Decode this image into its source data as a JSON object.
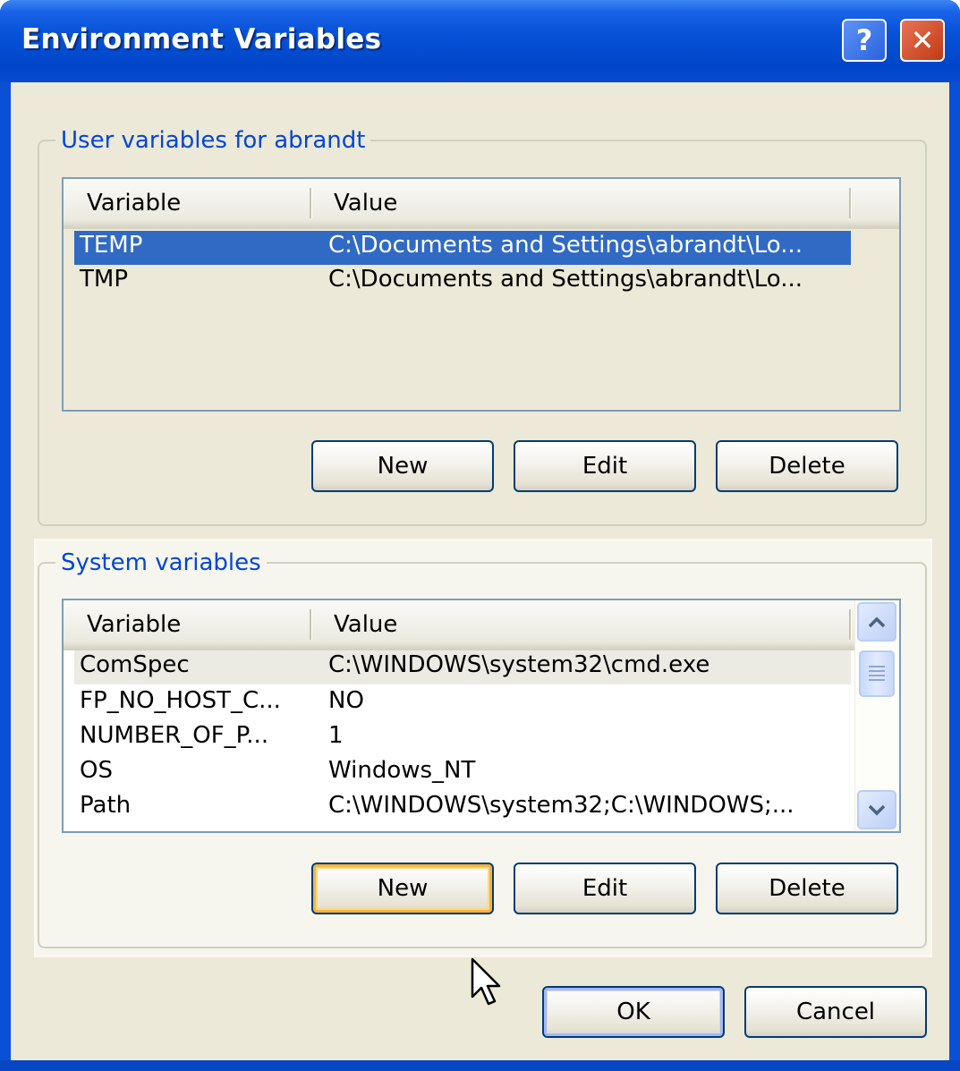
{
  "window": {
    "title": "Environment Variables",
    "help_glyph": "?",
    "close_glyph": "✕"
  },
  "user_group": {
    "label": "User variables for abrandt",
    "columns": [
      "Variable",
      "Value"
    ],
    "rows": [
      {
        "variable": "TEMP",
        "value": "C:\\Documents and Settings\\abrandt\\Lo..."
      },
      {
        "variable": "TMP",
        "value": "C:\\Documents and Settings\\abrandt\\Lo..."
      }
    ],
    "selected_row": "TEMP",
    "buttons": {
      "new": "New",
      "edit": "Edit",
      "delete": "Delete"
    }
  },
  "system_group": {
    "label": "System variables",
    "columns": [
      "Variable",
      "Value"
    ],
    "rows": [
      {
        "variable": "ComSpec",
        "value": "C:\\WINDOWS\\system32\\cmd.exe"
      },
      {
        "variable": "FP_NO_HOST_C...",
        "value": "NO"
      },
      {
        "variable": "NUMBER_OF_P...",
        "value": "1"
      },
      {
        "variable": "OS",
        "value": "Windows_NT"
      },
      {
        "variable": "Path",
        "value": "C:\\WINDOWS\\system32;C:\\WINDOWS;..."
      }
    ],
    "focused_row": "ComSpec",
    "buttons": {
      "new": "New",
      "edit": "Edit",
      "delete": "Delete"
    },
    "hovered_button": "New"
  },
  "dialog_buttons": {
    "ok": "OK",
    "cancel": "Cancel"
  },
  "colors": {
    "title_bar": "#0a50d6",
    "selection": "#316ac5",
    "group_label": "#0046d5",
    "dialog_bg": "#ece9d8"
  }
}
